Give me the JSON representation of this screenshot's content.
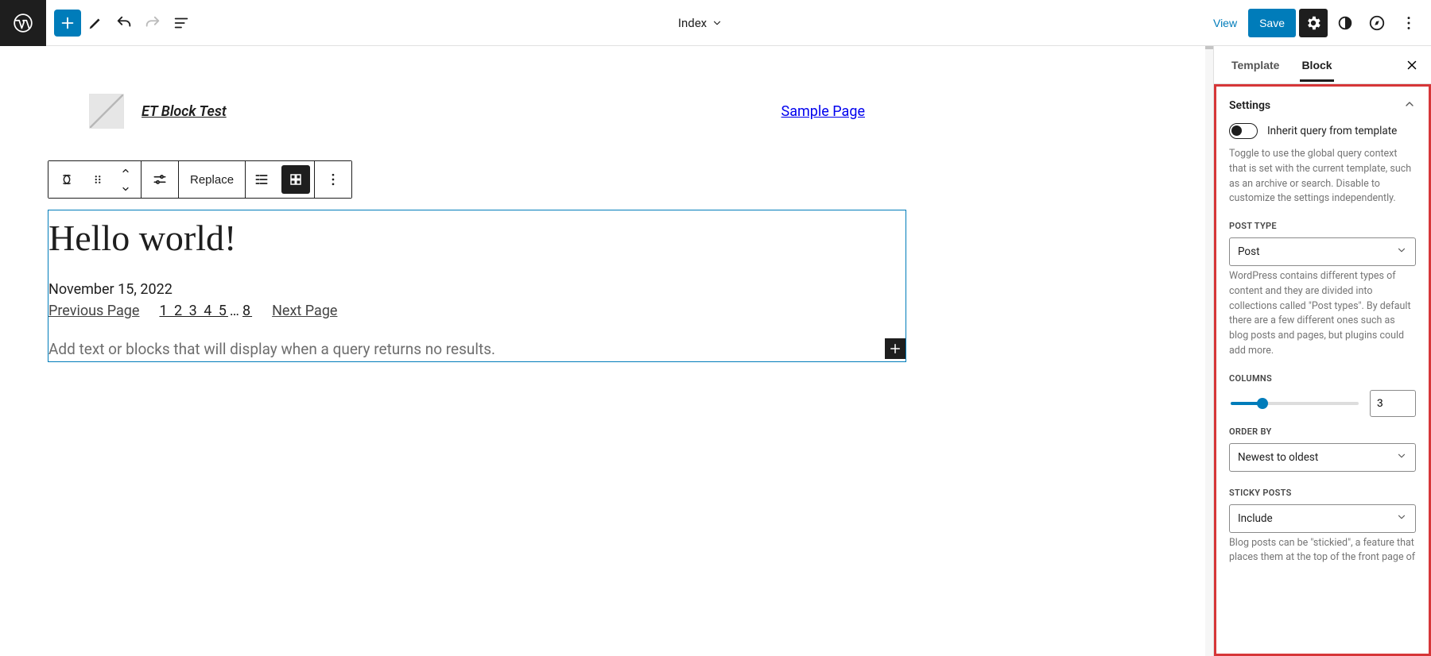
{
  "top": {
    "doc_title": "Index",
    "view": "View",
    "save": "Save"
  },
  "header": {
    "site_title": "ET Block Test",
    "nav_item": "Sample Page"
  },
  "toolbar": {
    "replace": "Replace"
  },
  "post": {
    "title": "Hello world!",
    "date": "November 15, 2022",
    "prev": "Previous Page",
    "next": "Next Page",
    "pages_prefix": "1 2 3 4 5",
    "pages_ellipsis": "…",
    "pages_last": "8",
    "no_results": "Add text or blocks that will display when a query returns no results."
  },
  "side": {
    "tab_template": "Template",
    "tab_block": "Block",
    "panel_title": "Settings",
    "inherit": {
      "label": "Inherit query from template",
      "help": "Toggle to use the global query context that is set with the current template, such as an archive or search. Disable to customize the settings independently."
    },
    "post_type": {
      "label": "POST TYPE",
      "value": "Post",
      "help": "WordPress contains different types of content and they are divided into collections called \"Post types\". By default there are a few different ones such as blog posts and pages, but plugins could add more."
    },
    "columns": {
      "label": "COLUMNS",
      "value": "3"
    },
    "order_by": {
      "label": "ORDER BY",
      "value": "Newest to oldest"
    },
    "sticky": {
      "label": "STICKY POSTS",
      "value": "Include",
      "help": "Blog posts can be \"stickied\", a feature that places them at the top of the front page of"
    }
  }
}
